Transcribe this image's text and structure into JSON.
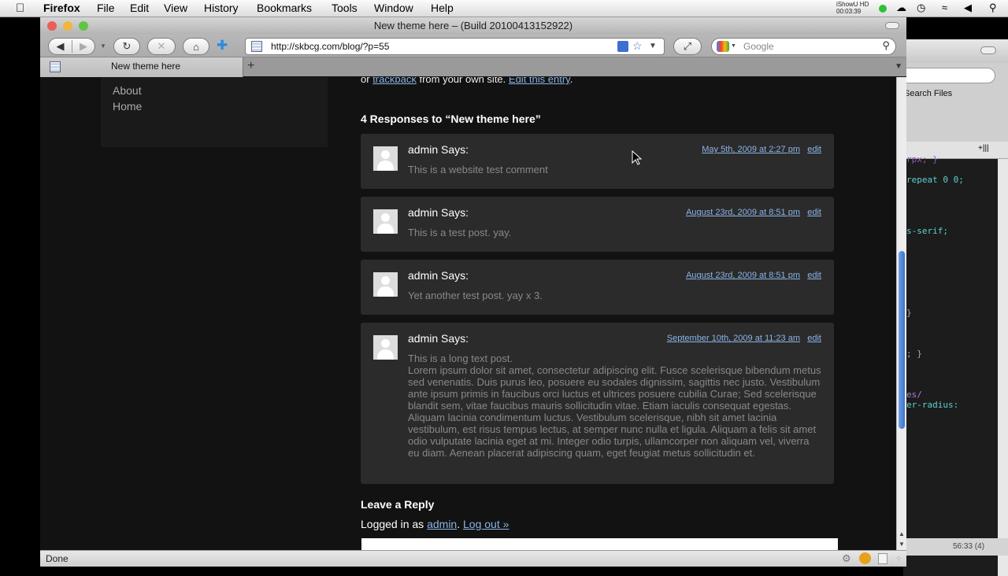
{
  "menubar": {
    "app": "Firefox",
    "items": [
      "File",
      "Edit",
      "View",
      "History",
      "Bookmarks",
      "Tools",
      "Window",
      "Help"
    ],
    "clock_line1": "iShowU HD",
    "clock_line2": "00:03:39"
  },
  "window": {
    "title": "New theme here – (Build 20100413152922)"
  },
  "toolbar": {
    "url": "http://skbcg.com/blog/?p=55",
    "search_placeholder": "Google"
  },
  "tab": {
    "label": "New theme here"
  },
  "background_window": {
    "search_files": "Search Files",
    "code_lines": [
      "rpx; }",
      "repeat 0 0;",
      "s-serif;",
      "}",
      "; }",
      "es/",
      "er-radius:"
    ],
    "status": "56:33 (4)"
  },
  "sidebar": {
    "links": [
      "About",
      "Home"
    ]
  },
  "post": {
    "topline_prefix": "or",
    "topline_trackback": "trackback",
    "topline_middle": "from your own site.",
    "topline_edit": "Edit this entry",
    "topline_end": "."
  },
  "comments_title": "4 Responses to “New theme here”",
  "comments": [
    {
      "author": "admin Says:",
      "date": "May 5th, 2009 at 2:27 pm",
      "edit": "edit",
      "text": "This is a website test comment"
    },
    {
      "author": "admin Says:",
      "date": "August 23rd, 2009 at 8:51 pm",
      "edit": "edit",
      "text": "This is a test post. yay."
    },
    {
      "author": "admin Says:",
      "date": "August 23rd, 2009 at 8:51 pm",
      "edit": "edit",
      "text": "Yet another test post. yay x 3."
    },
    {
      "author": "admin Says:",
      "date": "September 10th, 2009 at 11:23 am",
      "edit": "edit",
      "text": "This is a long text post.",
      "body": "Lorem ipsum dolor sit amet, consectetur adipiscing elit. Fusce scelerisque bibendum metus sed venenatis. Duis purus leo, posuere eu sodales dignissim, sagittis nec justo. Vestibulum ante ipsum primis in faucibus orci luctus et ultrices posuere cubilia Curae; Sed scelerisque blandit sem, vitae faucibus mauris sollicitudin vitae. Etiam iaculis consequat egestas. Aliquam lacinia condimentum luctus. Vestibulum scelerisque, nibh sit amet lacinia vestibulum, est risus tempus lectus, at semper nunc nulla et ligula. Aliquam a felis sit amet odio vulputate lacinia eget at mi. Integer odio turpis, ullamcorper non aliquam vel, viverra eu diam. Aenean placerat adipiscing quam, eget feugiat metus sollicitudin et."
    }
  ],
  "reply": {
    "title": "Leave a Reply",
    "logged_prefix": "Logged in as",
    "user": "admin",
    "sep": ".",
    "logout": "Log out »"
  },
  "status": {
    "text": "Done"
  },
  "colors": {
    "link": "#8ab4e6",
    "comment_bg": "#2b2b2b",
    "page_bg": "#121212"
  }
}
